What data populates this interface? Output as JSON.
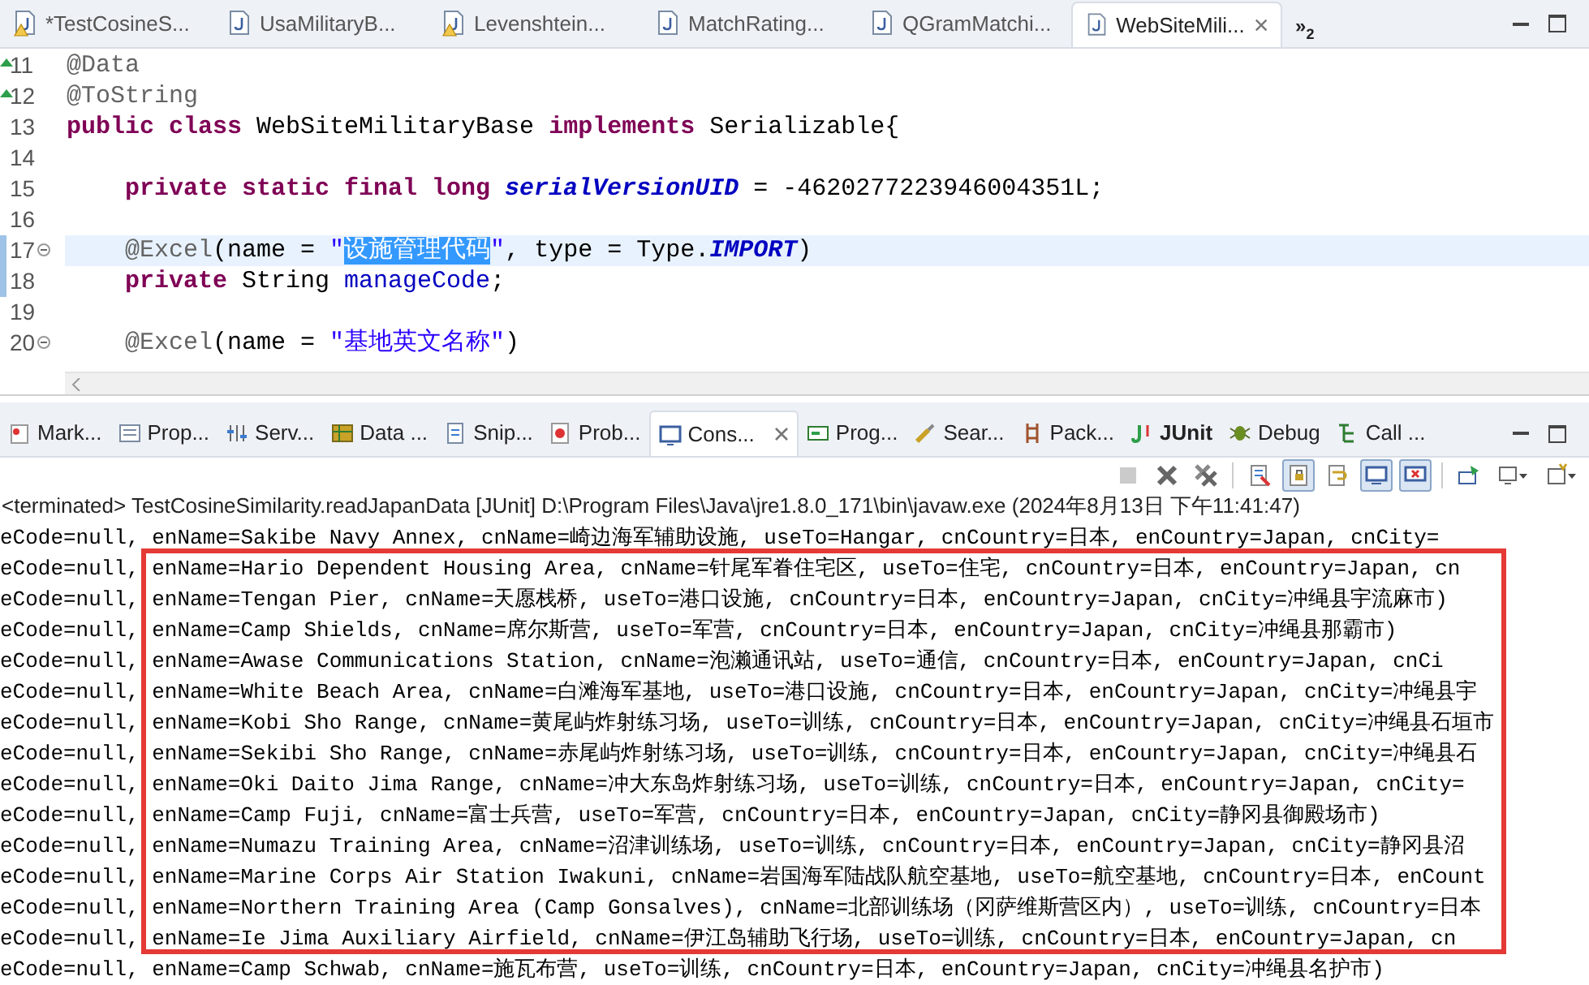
{
  "editor_tabs": [
    {
      "label": "*TestCosineS...",
      "selected": false,
      "warning": true
    },
    {
      "label": "UsaMilitaryB...",
      "selected": false,
      "warning": false
    },
    {
      "label": "Levenshtein...",
      "selected": false,
      "warning": true
    },
    {
      "label": "MatchRating...",
      "selected": false,
      "warning": false
    },
    {
      "label": "QGramMatchi...",
      "selected": false,
      "warning": false
    },
    {
      "label": "WebSiteMili...",
      "selected": true,
      "warning": false
    }
  ],
  "overflow_tabs": {
    "symbol": "»",
    "count": "2"
  },
  "code_lines": [
    {
      "number": "11",
      "marker": true,
      "fold": false,
      "changed": false,
      "current": false,
      "tokens": [
        {
          "kind": "annotation",
          "text": "@Data"
        }
      ]
    },
    {
      "number": "12",
      "marker": true,
      "fold": false,
      "changed": false,
      "current": false,
      "tokens": [
        {
          "kind": "annotation",
          "text": "@ToString"
        }
      ]
    },
    {
      "number": "13",
      "marker": false,
      "fold": false,
      "changed": false,
      "current": false,
      "tokens": [
        {
          "kind": "keyword",
          "text": "public class"
        },
        {
          "kind": "plain",
          "text": " WebSiteMilitaryBase "
        },
        {
          "kind": "keyword",
          "text": "implements"
        },
        {
          "kind": "plain",
          "text": " Serializable{"
        }
      ]
    },
    {
      "number": "14",
      "marker": false,
      "fold": false,
      "changed": false,
      "current": false
    },
    {
      "number": "15",
      "marker": false,
      "fold": false,
      "changed": false,
      "current": false,
      "tokens": [
        {
          "kind": "keyword",
          "text": "    private static final long "
        },
        {
          "kind": "static_field",
          "text": "serialVersionUID"
        },
        {
          "kind": "plain",
          "text": " = -4620277223946004351L;"
        }
      ]
    },
    {
      "number": "16",
      "marker": false,
      "fold": false,
      "changed": false,
      "current": false
    },
    {
      "number": "17",
      "marker": false,
      "fold": true,
      "changed": true,
      "current": true,
      "tokens": [
        {
          "kind": "annotation",
          "text": "    @Excel"
        },
        {
          "kind": "plain",
          "text": "(name = "
        },
        {
          "kind": "string",
          "text": "\""
        },
        {
          "kind": "selected_string",
          "text": "设施管理代码"
        },
        {
          "kind": "string",
          "text": "\""
        },
        {
          "kind": "plain",
          "text": ", type = Type."
        },
        {
          "kind": "constant",
          "text": "IMPORT"
        },
        {
          "kind": "plain",
          "text": ")"
        }
      ]
    },
    {
      "number": "18",
      "marker": false,
      "fold": false,
      "changed": true,
      "current": false,
      "tokens": [
        {
          "kind": "keyword",
          "text": "    private"
        },
        {
          "kind": "plain",
          "text": " String "
        },
        {
          "kind": "field",
          "text": "manageCode"
        },
        {
          "kind": "plain",
          "text": ";"
        }
      ]
    },
    {
      "number": "19",
      "marker": false,
      "fold": false,
      "changed": false,
      "current": false
    },
    {
      "number": "20",
      "marker": false,
      "fold": true,
      "changed": false,
      "current": false,
      "tokens": [
        {
          "kind": "annotation",
          "text": "    @Excel"
        },
        {
          "kind": "plain",
          "text": "(name = "
        },
        {
          "kind": "string",
          "text": "\"基地英文名称\""
        },
        {
          "kind": "plain",
          "text": ")"
        }
      ]
    }
  ],
  "view_tabs": [
    {
      "label": "Mark...",
      "kind": "markers",
      "selected": false,
      "bold": false
    },
    {
      "label": "Prop...",
      "kind": "properties",
      "selected": false,
      "bold": false
    },
    {
      "label": "Serv...",
      "kind": "servers",
      "selected": false,
      "bold": false
    },
    {
      "label": "Data ...",
      "kind": "data",
      "selected": false,
      "bold": false
    },
    {
      "label": "Snip...",
      "kind": "snippets",
      "selected": false,
      "bold": false
    },
    {
      "label": "Prob...",
      "kind": "problems",
      "selected": false,
      "bold": false
    },
    {
      "label": "Cons...",
      "kind": "console",
      "selected": true,
      "bold": false
    },
    {
      "label": "Prog...",
      "kind": "progress",
      "selected": false,
      "bold": false
    },
    {
      "label": "Sear...",
      "kind": "search",
      "selected": false,
      "bold": false
    },
    {
      "label": "Pack...",
      "kind": "packages",
      "selected": false,
      "bold": false
    },
    {
      "label": "JUnit",
      "kind": "junit",
      "selected": false,
      "bold": true
    },
    {
      "label": "Debug",
      "kind": "debug",
      "selected": false,
      "bold": false
    },
    {
      "label": "Call ...",
      "kind": "call",
      "selected": false,
      "bold": false
    }
  ],
  "console_toolbar": [
    {
      "kind": "stop",
      "pressed": false,
      "disabled": true
    },
    {
      "kind": "remove",
      "pressed": false,
      "disabled": false
    },
    {
      "kind": "remove_all",
      "pressed": false,
      "disabled": false
    },
    {
      "kind": "clear",
      "pressed": false,
      "disabled": false
    },
    {
      "kind": "scroll_lock",
      "pressed": true,
      "disabled": false
    },
    {
      "kind": "word_wrap",
      "pressed": false,
      "disabled": false
    },
    {
      "kind": "stdout",
      "pressed": true,
      "disabled": false
    },
    {
      "kind": "stderr",
      "pressed": true,
      "disabled": false
    },
    {
      "kind": "pin",
      "pressed": false,
      "disabled": false
    },
    {
      "kind": "display",
      "pressed": false,
      "disabled": false
    },
    {
      "kind": "new_console",
      "pressed": false,
      "disabled": false
    }
  ],
  "console_status": "<terminated> TestCosineSimilarity.readJapanData [JUnit] D:\\Program Files\\Java\\jre1.8.0_171\\bin\\javaw.exe (2024年8月13日 下午11:41:47)",
  "console_lines": [
    "eCode=null, enName=Sakibe Navy Annex, cnName=崎边海军辅助设施, useTo=Hangar, cnCountry=日本, enCountry=Japan, cnCity=",
    "eCode=null, enName=Hario Dependent Housing Area, cnName=针尾军眷住宅区, useTo=住宅, cnCountry=日本, enCountry=Japan, cn",
    "eCode=null, enName=Tengan Pier, cnName=天愿栈桥, useTo=港口设施, cnCountry=日本, enCountry=Japan, cnCity=冲绳县宇流麻市)",
    "eCode=null, enName=Camp Shields, cnName=席尔斯营, useTo=军营, cnCountry=日本, enCountry=Japan, cnCity=冲绳县那霸市)",
    "eCode=null, enName=Awase Communications Station, cnName=泡濑通讯站, useTo=通信, cnCountry=日本, enCountry=Japan, cnCi",
    "eCode=null, enName=White Beach Area, cnName=白滩海军基地, useTo=港口设施, cnCountry=日本, enCountry=Japan, cnCity=冲绳县宇",
    "eCode=null, enName=Kobi Sho Range, cnName=黄尾屿炸射练习场, useTo=训练, cnCountry=日本, enCountry=Japan, cnCity=冲绳县石垣市",
    "eCode=null, enName=Sekibi Sho Range, cnName=赤尾屿炸射练习场, useTo=训练, cnCountry=日本, enCountry=Japan, cnCity=冲绳县石",
    "eCode=null, enName=Oki Daito Jima Range, cnName=冲大东岛炸射练习场, useTo=训练, cnCountry=日本, enCountry=Japan, cnCity=",
    "eCode=null, enName=Camp Fuji, cnName=富士兵营, useTo=军营, cnCountry=日本, enCountry=Japan, cnCity=静冈县御殿场市)",
    "eCode=null, enName=Numazu Training Area, cnName=沼津训练场, useTo=训练, cnCountry=日本, enCountry=Japan, cnCity=静冈县沼",
    "eCode=null, enName=Marine Corps Air Station Iwakuni, cnName=岩国海军陆战队航空基地, useTo=航空基地, cnCountry=日本, enCount",
    "eCode=null, enName=Northern Training Area (Camp Gonsalves), cnName=北部训练场（冈萨维斯营区内）, useTo=训练, cnCountry=日本",
    "eCode=null, enName=Ie Jima Auxiliary Airfield, cnName=伊江岛辅助飞行场, useTo=训练, cnCountry=日本, enCountry=Japan, cn",
    "eCode=null, enName=Camp Schwab, cnName=施瓦布营, useTo=训练, cnCountry=日本, enCountry=Japan, cnCity=冲绳县名护市)"
  ]
}
